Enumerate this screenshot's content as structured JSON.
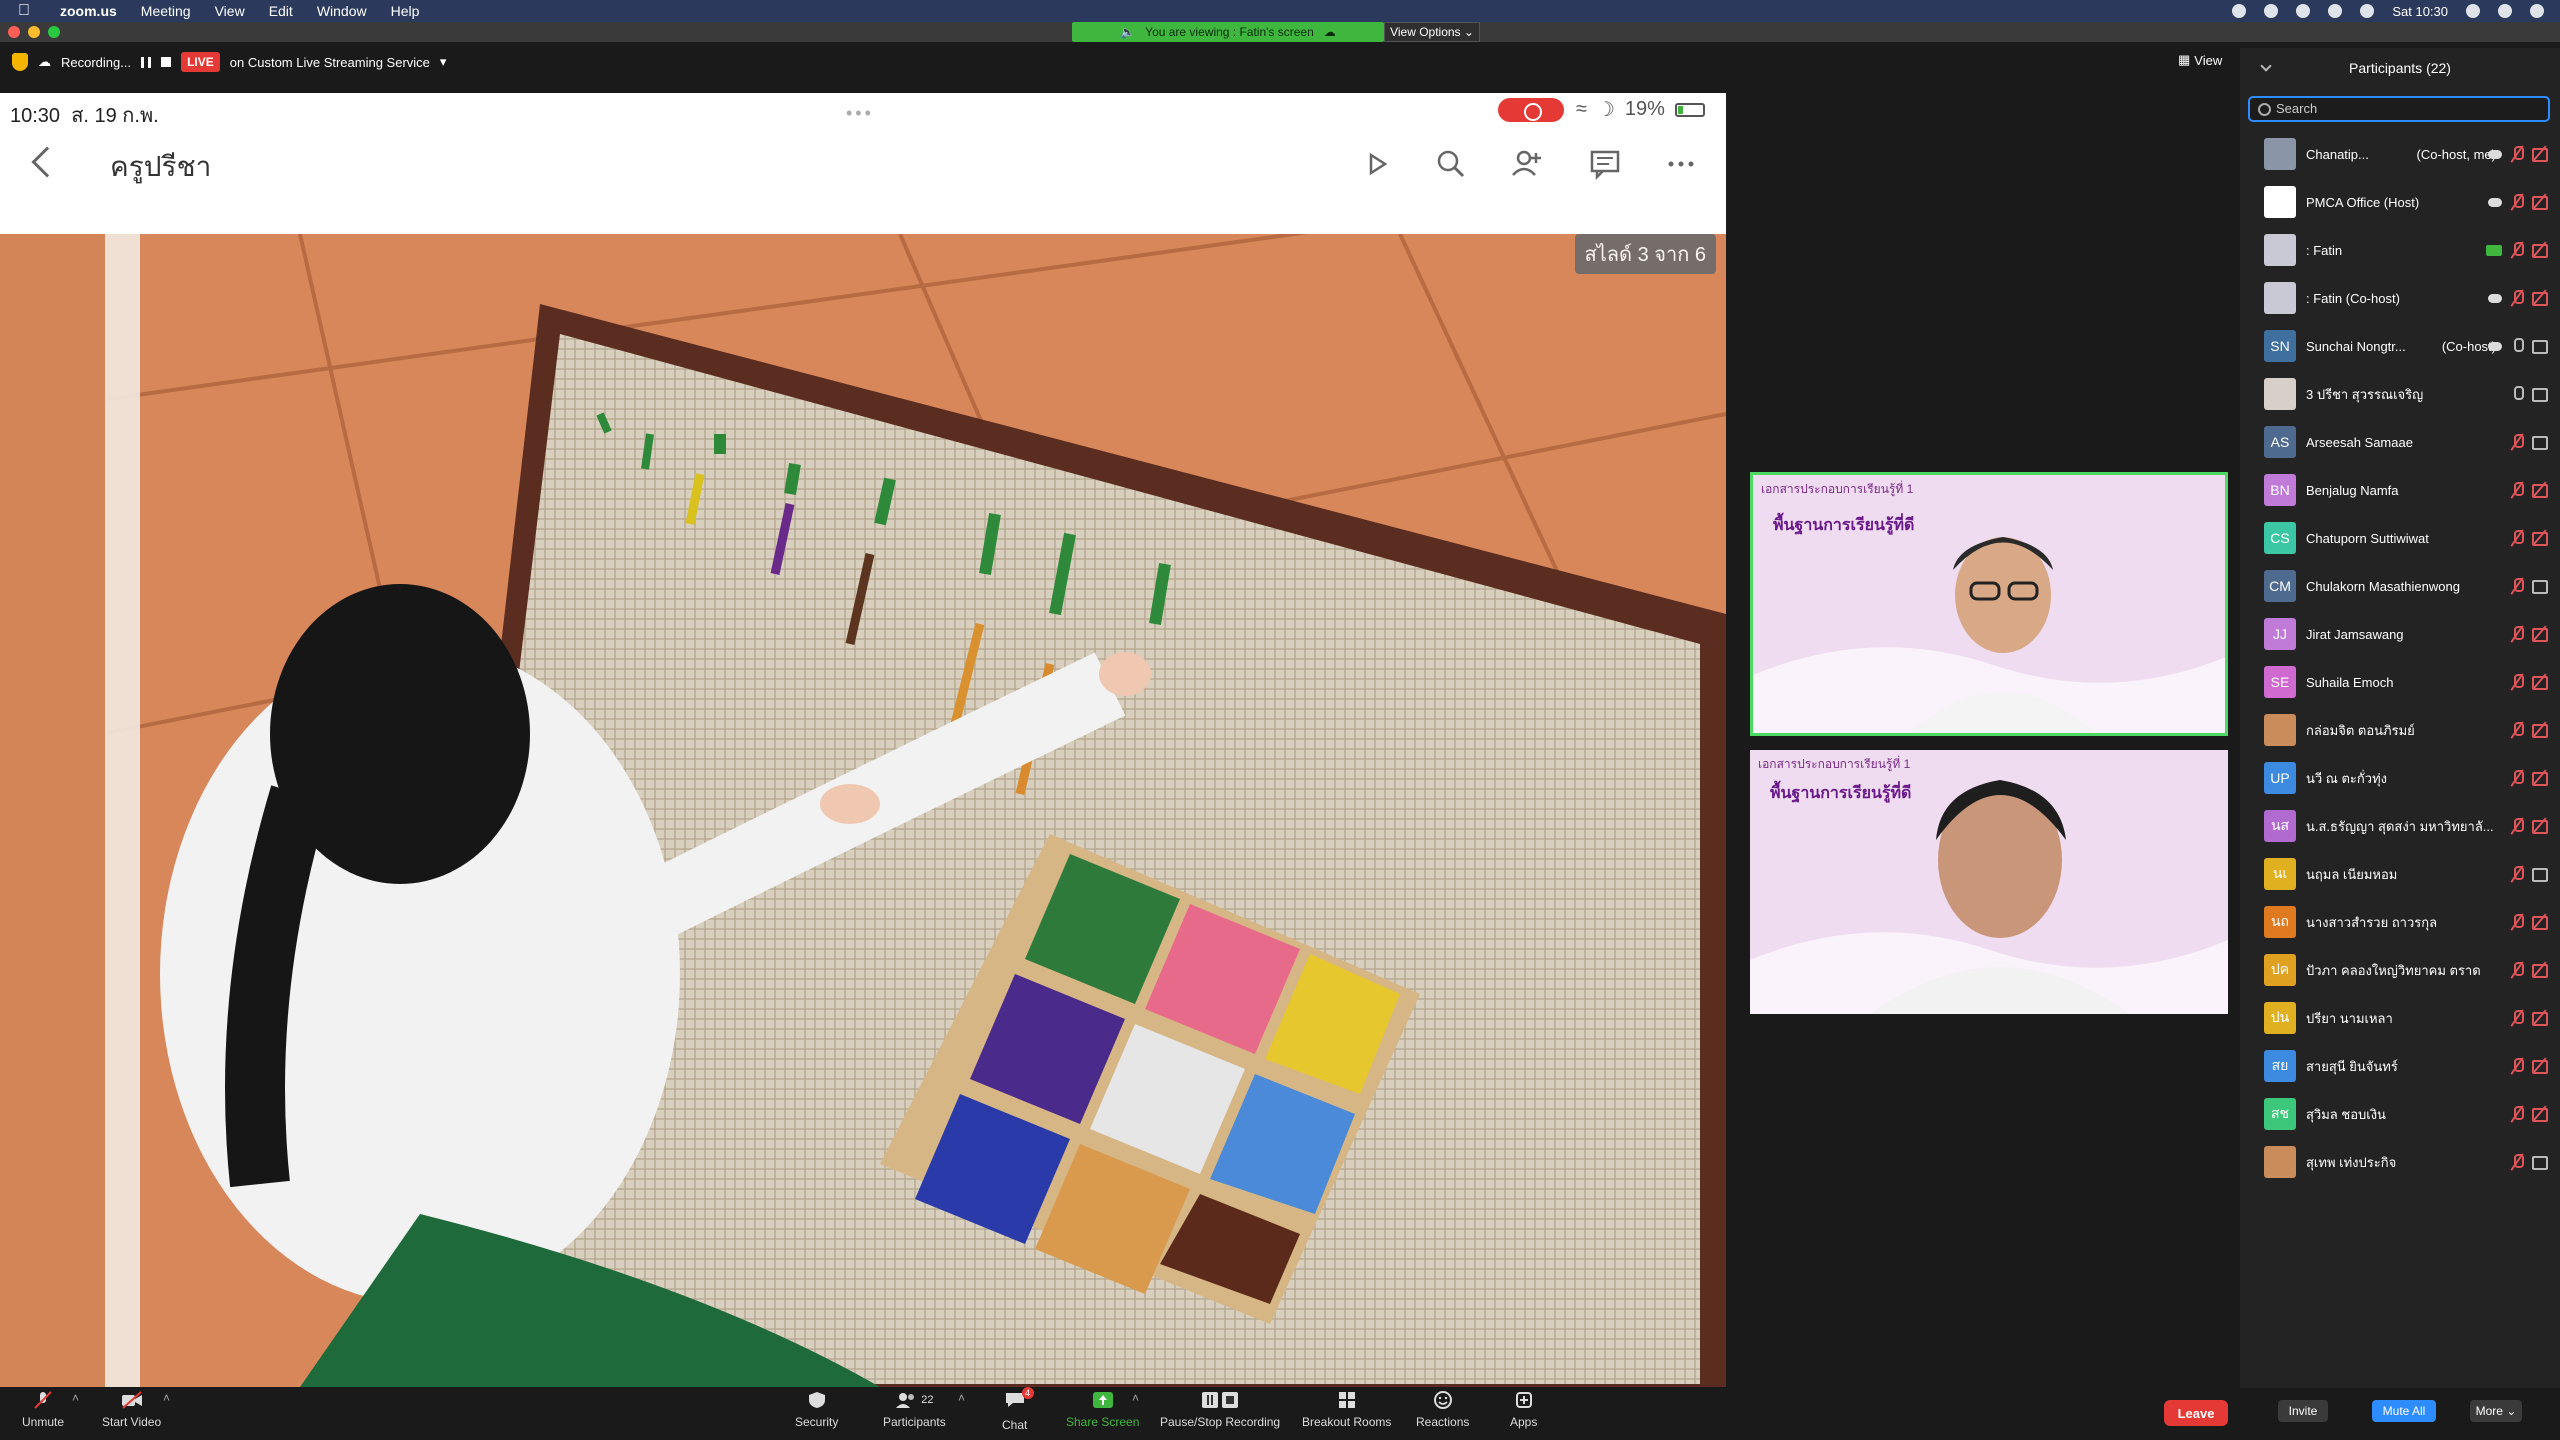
{
  "menubar": {
    "app": "zoom.us",
    "items": [
      "Meeting",
      "View",
      "Edit",
      "Window",
      "Help"
    ],
    "clock": "Sat 10:30"
  },
  "banner": {
    "viewing": "You are viewing : Fatin's screen",
    "view_options": "View Options"
  },
  "recbar": {
    "recording": "Recording...",
    "live": "LIVE",
    "service": "on Custom Live Streaming Service",
    "view": "View"
  },
  "phone": {
    "time": "10:30",
    "date": "ส. 19 ก.พ.",
    "battery": "19%",
    "app_title": "ครูปรีชา",
    "slide_counter": "สไลด์ 3 จาก 6"
  },
  "tiles": {
    "slide_title": "เอกสารประกอบการเรียนรู้ที่ 1",
    "slide_sub": "พื้นฐานการเรียนรู้ที่ดี"
  },
  "sidebar": {
    "title": "Participants (22)",
    "search_placeholder": "Search",
    "participants": [
      {
        "name": "Chanatip...",
        "role": "(Co-host, me)",
        "initials": "",
        "color": "#8a96a8",
        "photo": true,
        "cloud": true,
        "share": false,
        "mic": "off",
        "cam": "off"
      },
      {
        "name": "PMCA Office (Host)",
        "role": "",
        "initials": "",
        "color": "#ffffff",
        "photo": true,
        "cloud": true,
        "share": false,
        "mic": "off",
        "cam": "off"
      },
      {
        "name": ": Fatin",
        "role": "",
        "initials": "",
        "color": "#c9c9d6",
        "photo": true,
        "cloud": false,
        "share": true,
        "mic": "off",
        "cam": "off"
      },
      {
        "name": ": Fatin (Co-host)",
        "role": "",
        "initials": "",
        "color": "#c9c9d6",
        "photo": true,
        "cloud": true,
        "share": false,
        "mic": "off",
        "cam": "off"
      },
      {
        "name": "Sunchai Nongtr...",
        "role": "(Co-host)",
        "initials": "SN",
        "color": "#3f6f9f",
        "photo": false,
        "cloud": true,
        "share": false,
        "mic": "on",
        "cam": "on"
      },
      {
        "name": "3 ปรีชา สุวรรณเจริญ",
        "role": "",
        "initials": "",
        "color": "#d8d0c8",
        "photo": true,
        "cloud": false,
        "share": false,
        "mic": "on",
        "cam": "on"
      },
      {
        "name": "Arseesah Samaae",
        "role": "",
        "initials": "AS",
        "color": "#4f6a8f",
        "photo": false,
        "cloud": false,
        "share": false,
        "mic": "off",
        "cam": "on"
      },
      {
        "name": "Benjalug Namfa",
        "role": "",
        "initials": "BN",
        "color": "#c07ad8",
        "photo": false,
        "cloud": false,
        "share": false,
        "mic": "off",
        "cam": "off"
      },
      {
        "name": "Chatuporn Suttiwiwat",
        "role": "",
        "initials": "CS",
        "color": "#3cc7a4",
        "photo": false,
        "cloud": false,
        "share": false,
        "mic": "off",
        "cam": "off"
      },
      {
        "name": "Chulakorn Masathienwong",
        "role": "",
        "initials": "CM",
        "color": "#4f6a8f",
        "photo": false,
        "cloud": false,
        "share": false,
        "mic": "off",
        "cam": "on"
      },
      {
        "name": "Jirat Jamsawang",
        "role": "",
        "initials": "JJ",
        "color": "#c07ad8",
        "photo": false,
        "cloud": false,
        "share": false,
        "mic": "off",
        "cam": "off"
      },
      {
        "name": "Suhaila Emoch",
        "role": "",
        "initials": "SE",
        "color": "#d06ad0",
        "photo": false,
        "cloud": false,
        "share": false,
        "mic": "off",
        "cam": "off"
      },
      {
        "name": "กล่อมจิต ตอนภิรมย์",
        "role": "",
        "initials": "",
        "color": "#c98c5a",
        "photo": true,
        "cloud": false,
        "share": false,
        "mic": "off",
        "cam": "off"
      },
      {
        "name": "นวี ณ ตะกั่วทุ่ง",
        "role": "",
        "initials": "UP",
        "color": "#3c8be0",
        "photo": false,
        "cloud": false,
        "share": false,
        "mic": "off",
        "cam": "off"
      },
      {
        "name": "น.ส.ธรัญญา สุดสง่า มหาวิทยาลั...",
        "role": "",
        "initials": "นส",
        "color": "#b06ad0",
        "photo": false,
        "cloud": false,
        "share": false,
        "mic": "off",
        "cam": "off"
      },
      {
        "name": "นฤมล เนียมหอม",
        "role": "",
        "initials": "นเ",
        "color": "#e0b020",
        "photo": false,
        "cloud": false,
        "share": false,
        "mic": "off",
        "cam": "on"
      },
      {
        "name": "นางสาวสำรวย ถาวรกุล",
        "role": "",
        "initials": "นถ",
        "color": "#e07a20",
        "photo": false,
        "cloud": false,
        "share": false,
        "mic": "off",
        "cam": "off"
      },
      {
        "name": "ปัวภา คลองใหญ่วิทยาคม ตราด",
        "role": "",
        "initials": "ปค",
        "color": "#e0a020",
        "photo": false,
        "cloud": false,
        "share": false,
        "mic": "off",
        "cam": "off"
      },
      {
        "name": "ปรียา นามเหลา",
        "role": "",
        "initials": "ปน",
        "color": "#e0b020",
        "photo": false,
        "cloud": false,
        "share": false,
        "mic": "off",
        "cam": "off"
      },
      {
        "name": "สายสุนี ยินจันทร์",
        "role": "",
        "initials": "สย",
        "color": "#3c8be0",
        "photo": false,
        "cloud": false,
        "share": false,
        "mic": "off",
        "cam": "off"
      },
      {
        "name": "สุวิมล ชอบเงิน",
        "role": "",
        "initials": "สช",
        "color": "#3cc77a",
        "photo": false,
        "cloud": false,
        "share": false,
        "mic": "off",
        "cam": "off"
      },
      {
        "name": "สุเทพ เท่งประกิจ",
        "role": "",
        "initials": "",
        "color": "#c98c5a",
        "photo": true,
        "cloud": false,
        "share": false,
        "mic": "off",
        "cam": "on"
      }
    ],
    "invite": "Invite",
    "mute_all": "Mute All",
    "more": "More"
  },
  "toolbar": {
    "unmute": "Unmute",
    "start_video": "Start Video",
    "security": "Security",
    "participants": "Participants",
    "participants_count": "22",
    "chat": "Chat",
    "chat_badge": "4",
    "share_screen": "Share Screen",
    "pause_stop": "Pause/Stop Recording",
    "breakout": "Breakout Rooms",
    "reactions": "Reactions",
    "apps": "Apps",
    "leave": "Leave"
  }
}
